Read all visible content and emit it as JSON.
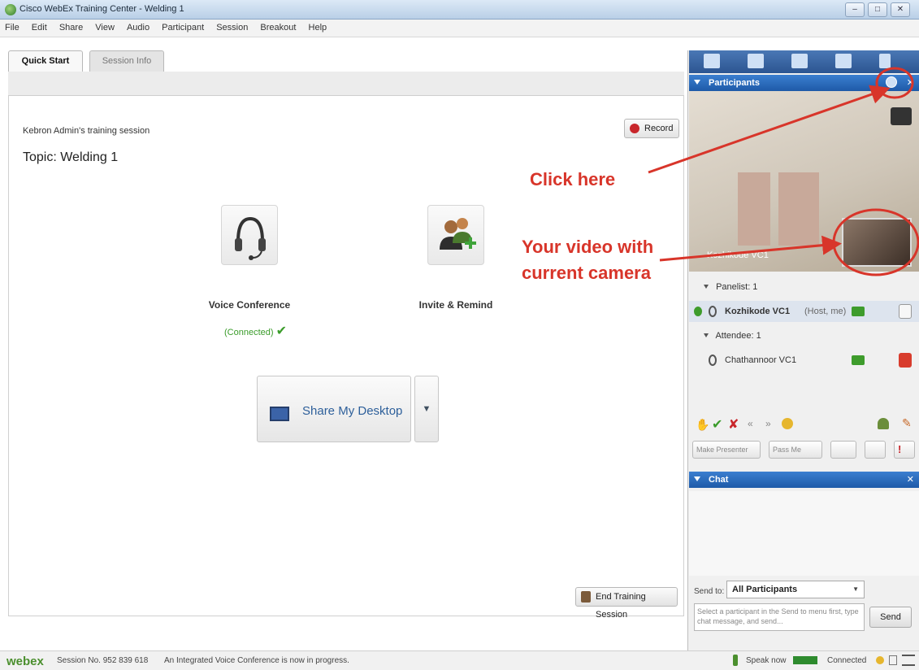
{
  "window": {
    "title": "Cisco WebEx Training Center - Welding 1"
  },
  "menu": [
    "File",
    "Edit",
    "Share",
    "View",
    "Audio",
    "Participant",
    "Session",
    "Breakout",
    "Help"
  ],
  "tabs": {
    "quick_start": "Quick Start",
    "session_info": "Session Info"
  },
  "main": {
    "session_name": "Kebron Admin's training session",
    "topic": "Topic:  Welding 1",
    "record_label": "Record",
    "voice_label": "Voice Conference",
    "voice_status": "(Connected)",
    "invite_label": "Invite & Remind",
    "share_label": "Share My Desktop",
    "end_label": "End Training Session"
  },
  "panel": {
    "participants_title": "Participants",
    "video_name": "Kozhikode VC1",
    "panelist_header": "Panelist: 1",
    "panelist_name": "Kozhikode VC1",
    "panelist_role": "(Host, me)",
    "attendee_header": "Attendee: 1",
    "attendee_name": "Chathannoor VC1",
    "make_presenter": "Make Presenter",
    "pass_me": "Pass Me",
    "chat_title": "Chat",
    "send_to_label": "Send to:",
    "send_to_value": "All Participants",
    "chat_placeholder": "Select a participant in the Send to menu first, type chat message, and send...",
    "send_label": "Send"
  },
  "status": {
    "brand": "webex",
    "session_no": "Session No. 952 839 618",
    "message": "An Integrated Voice Conference is now in progress.",
    "speak_now": "Speak now",
    "connected": "Connected"
  },
  "annotations": {
    "click_here": "Click here",
    "video_note_line1": "Your video with",
    "video_note_line2": "current camera"
  },
  "colors": {
    "accent": "#1e5aa8",
    "annotation": "#d8352a",
    "connected": "#3a9c2a"
  }
}
